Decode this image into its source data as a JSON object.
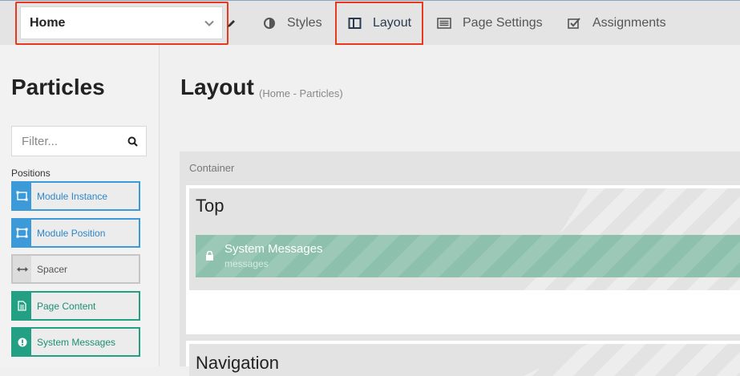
{
  "topbar": {
    "outline_selector": {
      "value": "Home"
    },
    "nav": [
      {
        "label": "Styles",
        "icon": "half-circle-icon"
      },
      {
        "label": "Layout",
        "icon": "columns-icon"
      },
      {
        "label": "Page Settings",
        "icon": "list-panel-icon"
      },
      {
        "label": "Assignments",
        "icon": "check-square-icon"
      }
    ]
  },
  "sidebar": {
    "title": "Particles",
    "filter": {
      "placeholder": "Filter...",
      "value": ""
    },
    "positions_label": "Positions",
    "particles": [
      {
        "label": "Module Instance",
        "icon": "module-instance-icon"
      },
      {
        "label": "Module Position",
        "icon": "module-position-icon"
      },
      {
        "label": "Spacer",
        "icon": "spacer-arrows-icon"
      },
      {
        "label": "Page Content",
        "icon": "document-icon"
      },
      {
        "label": "System Messages",
        "icon": "exclamation-icon"
      }
    ]
  },
  "main": {
    "title": "Layout",
    "subtitle": "(Home - Particles)",
    "container_label": "Container",
    "sections": [
      {
        "title": "Top",
        "particle": {
          "title": "System Messages",
          "subtitle": "messages",
          "icon": "lock-icon"
        }
      },
      {
        "title": "Navigation"
      }
    ]
  },
  "colors": {
    "highlight_outline": "#e8391e",
    "position_blue": "#3d9ad9",
    "particle_green": "#23a083",
    "locked_particle": "#8dc1ad"
  }
}
